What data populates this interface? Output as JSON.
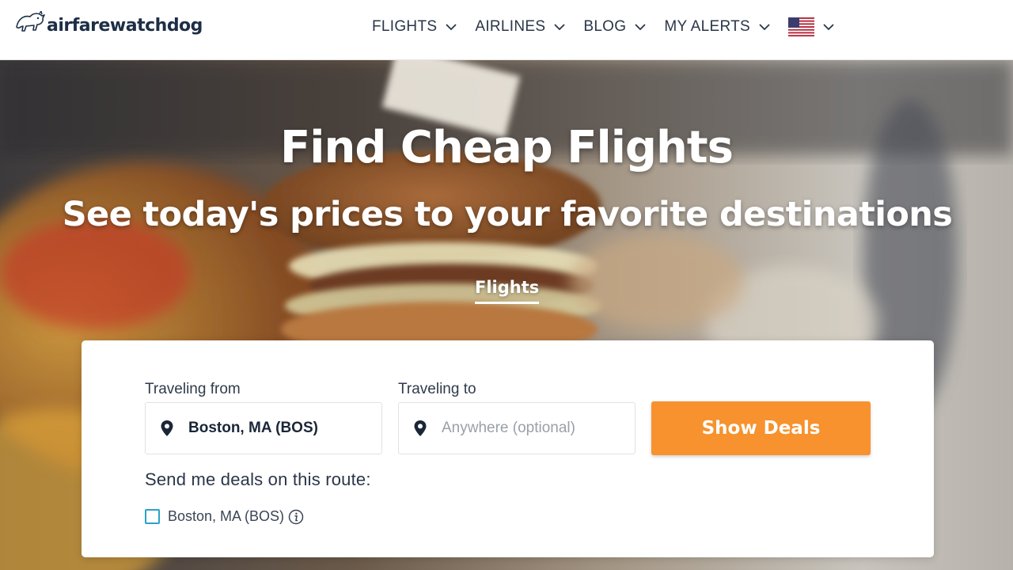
{
  "brand": {
    "name": "airfarewatchdog",
    "logo_icon": "dog-logo-icon"
  },
  "nav": {
    "items": [
      {
        "label": "FLIGHTS"
      },
      {
        "label": "AIRLINES"
      },
      {
        "label": "BLOG"
      },
      {
        "label": "MY ALERTS"
      }
    ],
    "locale_icon": "us-flag-icon"
  },
  "hero": {
    "title": "Find Cheap Flights",
    "subtitle": "See today's prices to your favorite destinations",
    "tab_label": "Flights"
  },
  "search": {
    "from_label": "Traveling from",
    "from_value": "Boston, MA (BOS)",
    "to_label": "Traveling to",
    "to_placeholder": "Anywhere (optional)",
    "button_label": "Show Deals",
    "deals_label": "Send me deals on this route:",
    "route_option": "Boston, MA (BOS)",
    "route_checked": false
  },
  "colors": {
    "accent": "#f7922e",
    "brand_navy": "#1d2e46",
    "checkbox_border": "#2aa3c9"
  }
}
